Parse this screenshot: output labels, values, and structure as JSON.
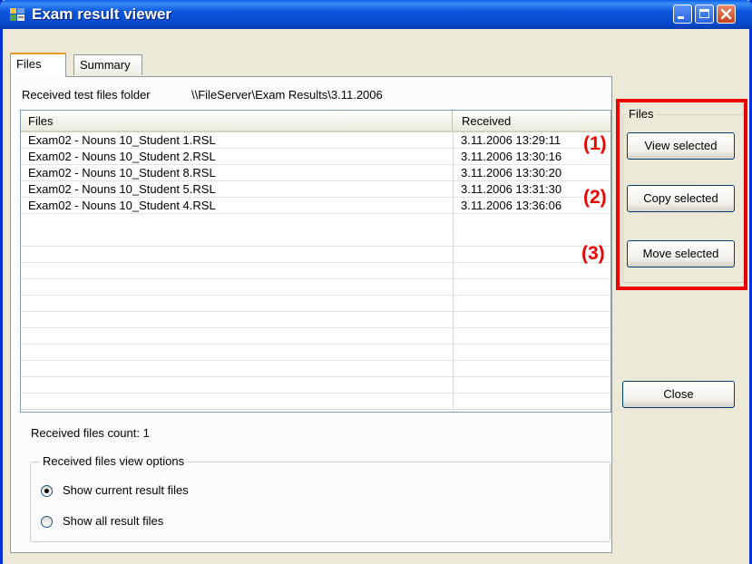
{
  "window": {
    "title": "Exam result viewer"
  },
  "tabs": [
    {
      "label": "Files",
      "active": true
    },
    {
      "label": "Summary",
      "active": false
    }
  ],
  "folder": {
    "label": "Received test files folder",
    "path": "\\\\FileServer\\Exam Results\\3.11.2006"
  },
  "list": {
    "columns": [
      "Files",
      "Received"
    ],
    "rows": [
      {
        "file": "Exam02 - Nouns 10_Student 1.RSL",
        "received": "3.11.2006 13:29:11"
      },
      {
        "file": "Exam02 - Nouns 10_Student 2.RSL",
        "received": "3.11.2006 13:30:16"
      },
      {
        "file": "Exam02 - Nouns 10_Student 8.RSL",
        "received": "3.11.2006 13:30:20"
      },
      {
        "file": "Exam02 - Nouns 10_Student 5.RSL",
        "received": "3.11.2006 13:31:30"
      },
      {
        "file": "Exam02 - Nouns 10_Student 4.RSL",
        "received": "3.11.2006 13:36:06"
      }
    ]
  },
  "files_group": {
    "label": "Files",
    "view_label": "View selected",
    "copy_label": "Copy selected",
    "move_label": "Move selected"
  },
  "markers": {
    "m1": "(1)",
    "m2": "(2)",
    "m3": "(3)"
  },
  "close_label": "Close",
  "count": {
    "label": "Received files count:  1"
  },
  "view_options": {
    "label": "Received files view options",
    "options": [
      {
        "label": "Show current result files",
        "checked": true
      },
      {
        "label": "Show all result files",
        "checked": false
      }
    ]
  },
  "colors": {
    "highlight": "#ee0000",
    "titlebar": "#0b56de",
    "window_bg": "#ece9d8"
  }
}
